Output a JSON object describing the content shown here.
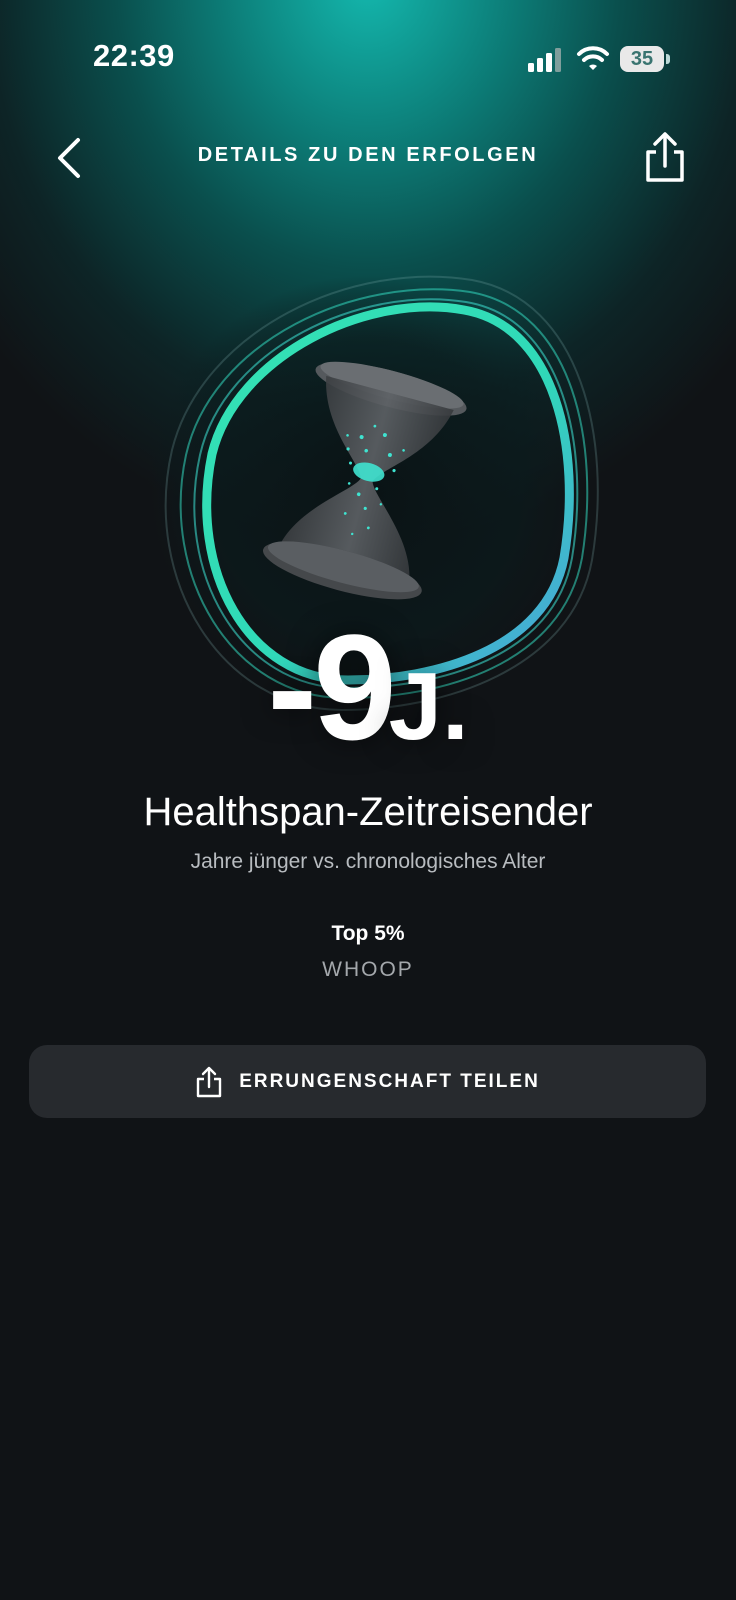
{
  "status_bar": {
    "time": "22:39",
    "battery_level": "35"
  },
  "header": {
    "title": "DETAILS ZU DEN ERFOLGEN",
    "back_icon": "chevron-left-icon",
    "share_icon": "share-icon"
  },
  "achievement": {
    "badge_icon": "hourglass-icon",
    "value": "-9",
    "unit": "J.",
    "title": "Healthspan-Zeitreisender",
    "subtitle": "Jahre jünger vs. chronologisches Alter",
    "rank": "Top 5%",
    "brand": "WHOOP"
  },
  "share_button": {
    "label": "ERRUNGENSCHAFT TEILEN",
    "icon": "share-icon"
  },
  "colors": {
    "accent_teal": "#14b8ae",
    "ring_green": "#3ee0b0",
    "ring_blue": "#4aa8d8",
    "background": "#101316",
    "button_bg": "#272a2e"
  }
}
